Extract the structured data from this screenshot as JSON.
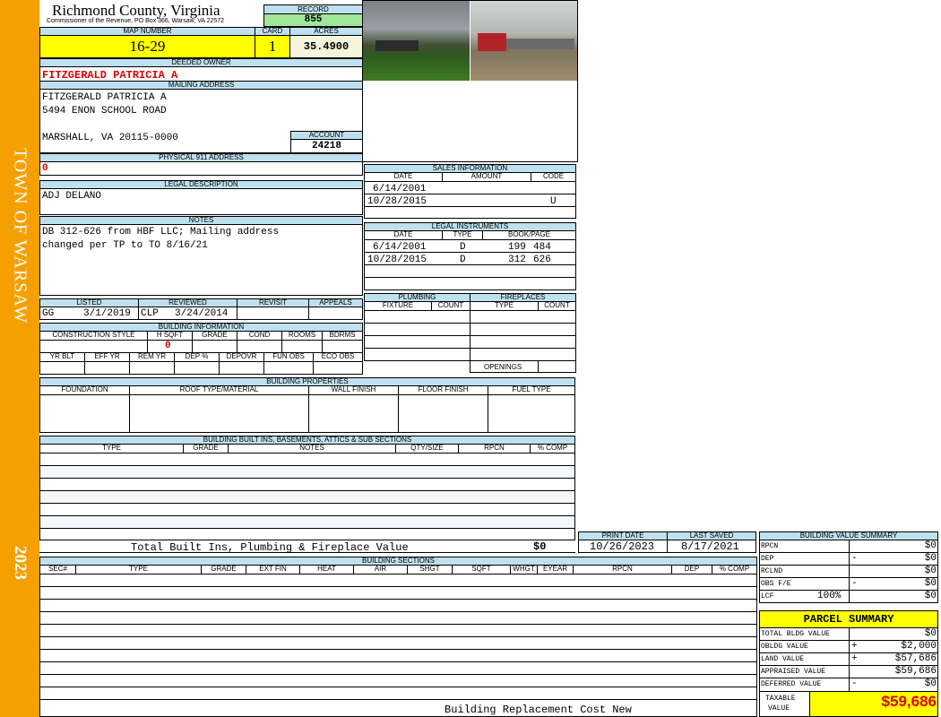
{
  "sidebar": {
    "town": "TOWN OF WARSAW",
    "year": "2023"
  },
  "header": {
    "county": "Richmond County, Virginia",
    "commissioner": "Commissioner of the Revenue, PO Box 366, Warsaw, VA 22572",
    "record_label": "RECORD",
    "record": "855",
    "map_label": "MAP NUMBER",
    "map_number": "16-29",
    "card_label": "CARD",
    "card": "1",
    "acres_label": "ACRES",
    "acres": "35.4900"
  },
  "owner": {
    "deeded_label": "DEEDED OWNER",
    "deeded_owner": "FITZGERALD PATRICIA A",
    "mailing_label": "MAILING ADDRESS",
    "mail_line1": "FITZGERALD PATRICIA A",
    "mail_line2": "5494 ENON SCHOOL ROAD",
    "mail_line3": "MARSHALL, VA 20115-0000",
    "account_label": "ACCOUNT",
    "account": "24218",
    "physical_label": "PHYSICAL 911 ADDRESS",
    "physical": "0"
  },
  "legal": {
    "label": "LEGAL DESCRIPTION",
    "text": "ADJ DELANO"
  },
  "notes": {
    "label": "NOTES",
    "line1": "DB 312-626 from HBF LLC; Mailing address",
    "line2": "changed per TP to TO 8/16/21"
  },
  "review": {
    "listed_label": "LISTED",
    "reviewed_label": "REVIEWED",
    "revisit_label": "REVISIT",
    "appeals_label": "APPEALS",
    "listed_by": "GG",
    "listed_date": "3/1/2019",
    "reviewed_by": "CLP",
    "reviewed_date": "3/24/2014"
  },
  "building_info": {
    "label": "BUILDING INFORMATION",
    "cols1": [
      "CONSTRUCTION STYLE",
      "H SQFT",
      "GRADE",
      "COND",
      "ROOMS",
      "BDRMS"
    ],
    "hsqft": "0",
    "cols2": [
      "YR BLT",
      "EFF YR",
      "REM YR",
      "DEP %",
      "DEPOVR",
      "FUN OBS",
      "ECO OBS"
    ]
  },
  "sales": {
    "label": "SALES INFORMATION",
    "cols": [
      "DATE",
      "AMOUNT",
      "CODE"
    ],
    "rows": [
      {
        "date": "6/14/2001",
        "amount": "",
        "code": ""
      },
      {
        "date": "10/28/2015",
        "amount": "",
        "code": "U"
      }
    ]
  },
  "instruments": {
    "label": "LEGAL INSTRUMENTS",
    "cols": [
      "DATE",
      "TYPE",
      "BOOK/PAGE"
    ],
    "rows": [
      {
        "date": "6/14/2001",
        "type": "D",
        "book": "199",
        "page": "484"
      },
      {
        "date": "10/28/2015",
        "type": "D",
        "book": "312",
        "page": "626"
      }
    ]
  },
  "plumbing": {
    "label": "PLUMBING",
    "cols": [
      "FIXTURE",
      "COUNT"
    ]
  },
  "fireplaces": {
    "label": "FIREPLACES",
    "cols": [
      "TYPE",
      "COUNT"
    ],
    "openings": "OPENINGS"
  },
  "properties": {
    "label": "BUILDING PROPERTIES",
    "cols": [
      "FOUNDATION",
      "ROOF TYPE/MATERIAL",
      "WALL FINISH",
      "FLOOR FINISH",
      "FUEL TYPE"
    ]
  },
  "builtins": {
    "label": "BUILDING BUILT INS, BASEMENTS, ATTICS & SUB SECTIONS",
    "cols": [
      "TYPE",
      "GRADE",
      "NOTES",
      "QTY/SIZE",
      "RPCN",
      "% COMP"
    ],
    "total_label": "Total Built Ins, Plumbing & Fireplace Value",
    "total": "$0"
  },
  "print": {
    "print_label": "PRINT DATE",
    "print_date": "10/26/2023",
    "saved_label": "LAST SAVED",
    "saved_date": "8/17/2021"
  },
  "sections": {
    "label": "BUILDING SECTIONS",
    "cols": [
      "SEC#",
      "TYPE",
      "GRADE",
      "EXT FIN",
      "HEAT",
      "AIR",
      "SHGT",
      "SQFT",
      "WHGT",
      "EYEAR",
      "RPCN",
      "DEP",
      "% COMP"
    ],
    "footer": "Building Replacement Cost New"
  },
  "bvs": {
    "label": "BUILDING VALUE SUMMARY",
    "rows": [
      {
        "label": "RPCN",
        "sign": "",
        "value": "$0"
      },
      {
        "label": "DEP",
        "sign": "-",
        "value": "$0"
      },
      {
        "label": "RCLND",
        "sign": "",
        "value": "$0"
      },
      {
        "label": "OBS F/E",
        "sign": "-",
        "value": "$0"
      },
      {
        "label": "LCF",
        "sign": "",
        "value": "$0"
      }
    ],
    "lcf_pct": "100%"
  },
  "parcel": {
    "label": "PARCEL SUMMARY",
    "rows": [
      {
        "label": "TOTAL BLDG VALUE",
        "sign": "",
        "value": "$0"
      },
      {
        "label": "OBLDG VALUE",
        "sign": "+",
        "value": "$2,000"
      },
      {
        "label": "LAND VALUE",
        "sign": "+",
        "value": "$57,686"
      },
      {
        "label": "APPRAISED VALUE",
        "sign": "",
        "value": "$59,686"
      },
      {
        "label": "DEFERRED VALUE",
        "sign": "-",
        "value": "$0"
      }
    ],
    "taxable_label1": "TAXABLE",
    "taxable_label2": "VALUE",
    "taxable_value": "$59,686"
  }
}
